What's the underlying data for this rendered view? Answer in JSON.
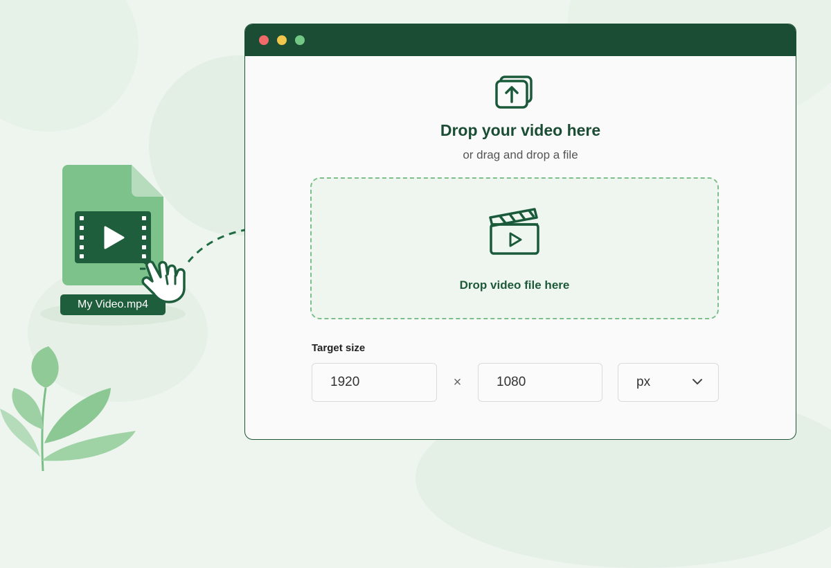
{
  "file": {
    "name": "My Video.mp4",
    "icons": [
      "video-file-icon",
      "play-icon",
      "hand-cursor-icon"
    ]
  },
  "window": {
    "upload": {
      "icon": "upload-icon",
      "title": "Drop your video here",
      "subtitle": "or drag and drop a file"
    },
    "dropzone": {
      "icon": "clapperboard-play-icon",
      "label": "Drop video file here"
    },
    "target_size": {
      "label": "Target size",
      "width": "1920",
      "separator": "×",
      "height": "1080",
      "unit": "px"
    }
  },
  "colors": {
    "brand_dark_green": "#1a4d33",
    "accent_green": "#7dbf8c",
    "background": "#eef5ef"
  }
}
